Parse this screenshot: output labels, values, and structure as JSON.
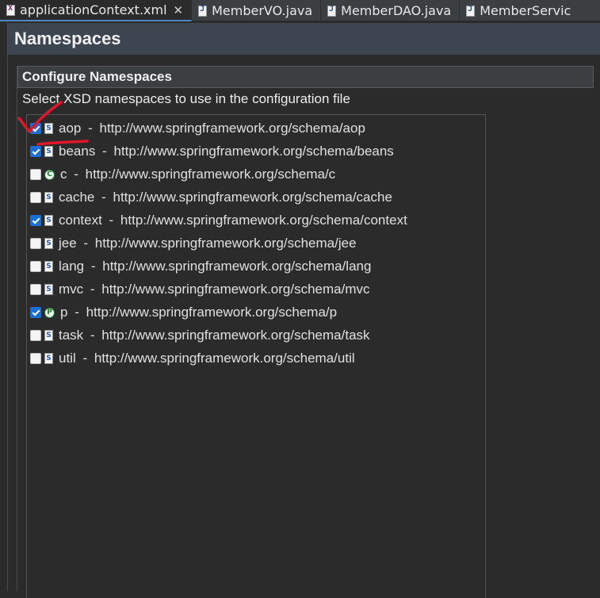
{
  "tabs": [
    {
      "label": "applicationContext.xml",
      "icon": "xml-file-icon",
      "active": true
    },
    {
      "label": "MemberVO.java",
      "icon": "java-file-icon"
    },
    {
      "label": "MemberDAO.java",
      "icon": "java-file-icon"
    },
    {
      "label": "MemberServic",
      "icon": "java-file-icon"
    }
  ],
  "editor": {
    "title": "Namespaces",
    "section_title": "Configure Namespaces",
    "description": "Select XSD namespaces to use in the configuration file"
  },
  "namespaces": [
    {
      "prefix": "aop",
      "separator": " - ",
      "uri": "http://www.springframework.org/schema/aop",
      "checked": true,
      "icon": "S"
    },
    {
      "prefix": "beans",
      "separator": " - ",
      "uri": "http://www.springframework.org/schema/beans",
      "checked": true,
      "icon": "S"
    },
    {
      "prefix": "c",
      "separator": " - ",
      "uri": "http://www.springframework.org/schema/c",
      "checked": false,
      "icon": "C"
    },
    {
      "prefix": "cache",
      "separator": " - ",
      "uri": "http://www.springframework.org/schema/cache",
      "checked": false,
      "icon": "S"
    },
    {
      "prefix": "context",
      "separator": " - ",
      "uri": "http://www.springframework.org/schema/context",
      "checked": true,
      "icon": "S"
    },
    {
      "prefix": "jee",
      "separator": " - ",
      "uri": "http://www.springframework.org/schema/jee",
      "checked": false,
      "icon": "S"
    },
    {
      "prefix": "lang",
      "separator": " - ",
      "uri": "http://www.springframework.org/schema/lang",
      "checked": false,
      "icon": "S"
    },
    {
      "prefix": "mvc",
      "separator": " - ",
      "uri": "http://www.springframework.org/schema/mvc",
      "checked": false,
      "icon": "S"
    },
    {
      "prefix": "p",
      "separator": " - ",
      "uri": "http://www.springframework.org/schema/p",
      "checked": true,
      "icon": "P"
    },
    {
      "prefix": "task",
      "separator": " - ",
      "uri": "http://www.springframework.org/schema/task",
      "checked": false,
      "icon": "S"
    },
    {
      "prefix": "util",
      "separator": " - ",
      "uri": "http://www.springframework.org/schema/util",
      "checked": false,
      "icon": "S"
    }
  ],
  "colors": {
    "accent": "#1a6fd6",
    "annotation": "#e0162b"
  }
}
